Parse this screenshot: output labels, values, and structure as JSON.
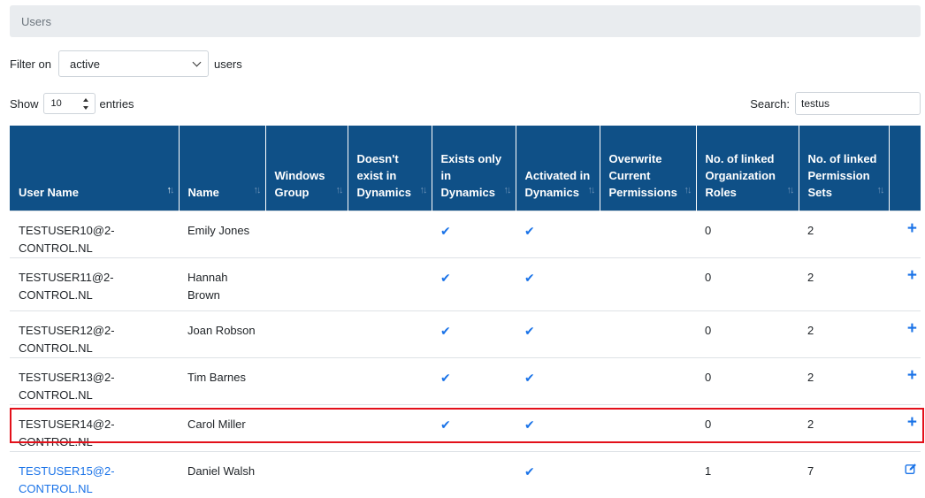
{
  "breadcrumb": {
    "title": "Users"
  },
  "filter": {
    "label": "Filter on",
    "selected": "active",
    "suffix": "users"
  },
  "length": {
    "show_label": "Show",
    "selected": "10",
    "entries_label": "entries"
  },
  "search": {
    "label": "Search:",
    "value": "testus"
  },
  "columns": [
    "User Name",
    "Name",
    "Windows Group",
    "Doesn't exist in Dynamics",
    "Exists only in Dynamics",
    "Activated in Dynamics",
    "Overwrite Current Permissions",
    "No. of linked Organization Roles",
    "No. of linked Permission Sets",
    ""
  ],
  "rows": [
    {
      "user": "TESTUSER10@2-CONTROL.NL",
      "name": "Emily Jones",
      "windows_group": "",
      "not_in_dynamics": "",
      "exists_only": "✔",
      "activated": "✔",
      "overwrite": "",
      "org_roles": "0",
      "perm_sets": "2",
      "action": "plus-icon"
    },
    {
      "user": "TESTUSER11@2-CONTROL.NL",
      "name": "Hannah Brown",
      "windows_group": "",
      "not_in_dynamics": "",
      "exists_only": "✔",
      "activated": "✔",
      "overwrite": "",
      "org_roles": "0",
      "perm_sets": "2",
      "action": "plus-icon"
    },
    {
      "user": "TESTUSER12@2-CONTROL.NL",
      "name": "Joan Robson",
      "windows_group": "",
      "not_in_dynamics": "",
      "exists_only": "✔",
      "activated": "✔",
      "overwrite": "",
      "org_roles": "0",
      "perm_sets": "2",
      "action": "plus-icon"
    },
    {
      "user": "TESTUSER13@2-CONTROL.NL",
      "name": "Tim Barnes",
      "windows_group": "",
      "not_in_dynamics": "",
      "exists_only": "✔",
      "activated": "✔",
      "overwrite": "",
      "org_roles": "0",
      "perm_sets": "2",
      "action": "plus-icon"
    },
    {
      "user": "TESTUSER14@2-CONTROL.NL",
      "name": "Carol Miller",
      "windows_group": "",
      "not_in_dynamics": "",
      "exists_only": "✔",
      "activated": "✔",
      "overwrite": "",
      "org_roles": "0",
      "perm_sets": "2",
      "action": "plus-icon"
    },
    {
      "user": "TESTUSER15@2-CONTROL.NL",
      "name": "Daniel Walsh",
      "windows_group": "",
      "not_in_dynamics": "",
      "exists_only": "",
      "activated": "✔",
      "overwrite": "",
      "org_roles": "1",
      "perm_sets": "7",
      "action": "edit-icon"
    }
  ],
  "colors": {
    "header_bg": "#0f5087",
    "accent": "#1a73e8",
    "highlight": "#e3101a"
  }
}
